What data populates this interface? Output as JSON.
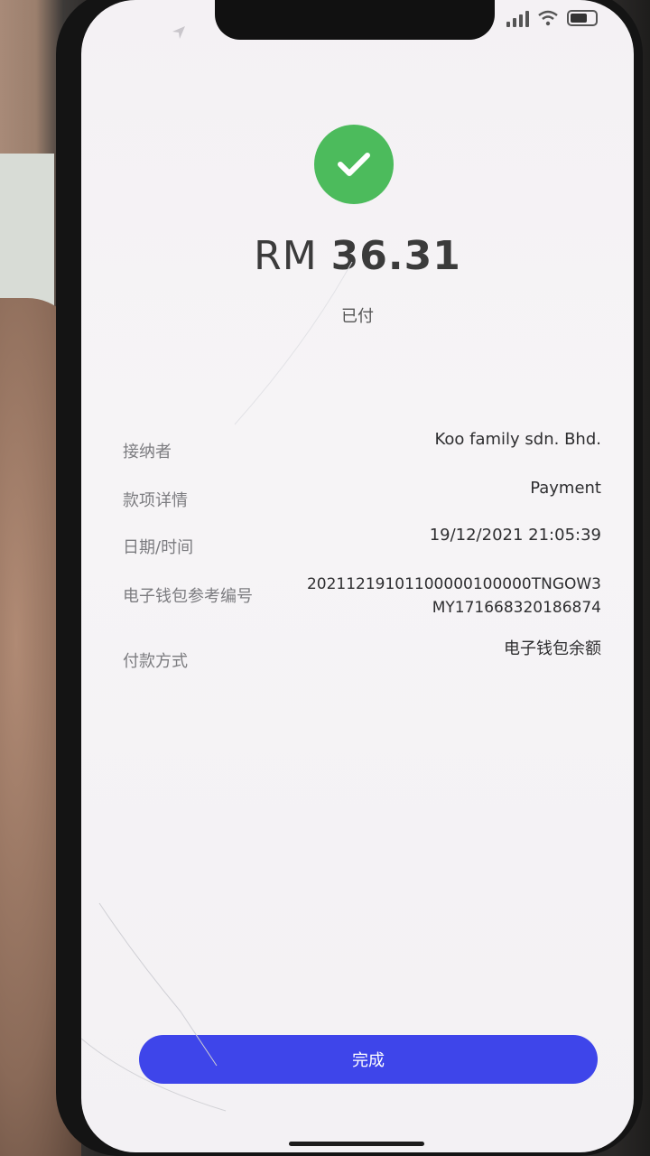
{
  "amount": {
    "currency": "RM",
    "value": "36.31"
  },
  "status": "已付",
  "details": [
    {
      "label": "接纳者",
      "value": "Koo family sdn. Bhd."
    },
    {
      "label": "款项详情",
      "value": "Payment"
    },
    {
      "label": "日期/时间",
      "value": "19/12/2021 21:05:39"
    },
    {
      "label": "电子钱包参考编号",
      "value_line1": "20211219101100000100000TNGOW3",
      "value_line2": "MY171668320186874"
    },
    {
      "label": "付款方式",
      "value": "电子钱包余额"
    }
  ],
  "done_button": "完成",
  "colors": {
    "success": "#4cbb5c",
    "primary_button": "#3e45ea"
  },
  "icons": {
    "success": "check-icon",
    "location": "location-arrow-icon",
    "signal": "cellular-signal-icon",
    "wifi": "wifi-icon",
    "battery": "battery-icon"
  }
}
